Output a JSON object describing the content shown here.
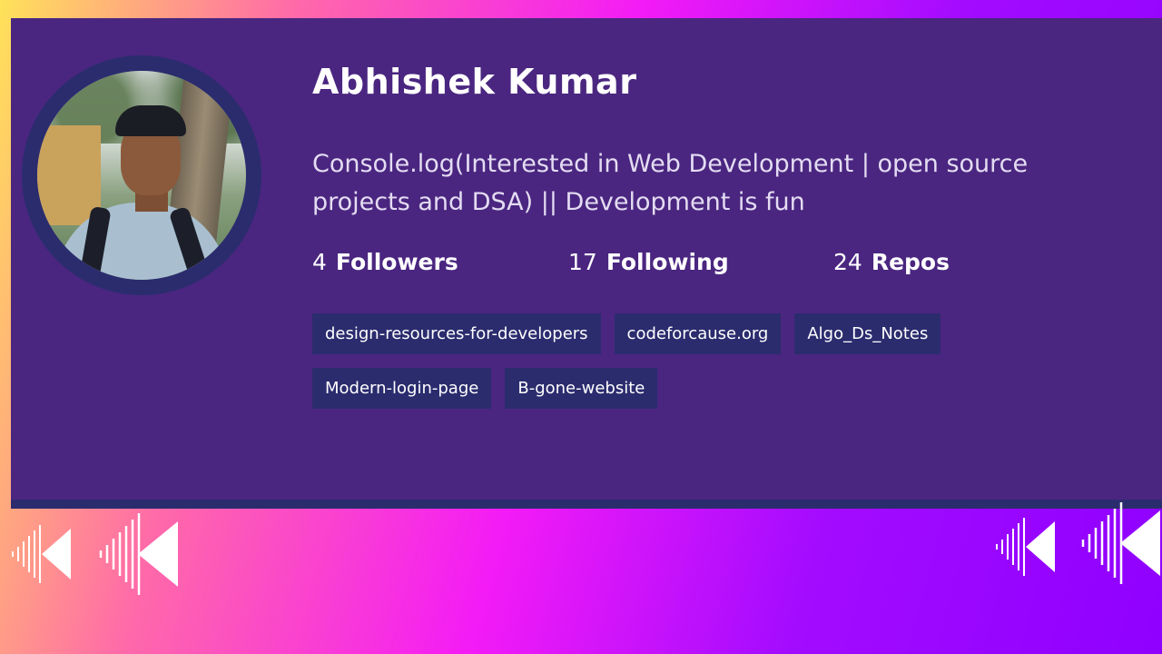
{
  "profile": {
    "name": "Abhishek Kumar",
    "bio": "Console.log(Interested in Web Development | open source projects and DSA) || Development is fun",
    "avatar_icon": "profile-photo"
  },
  "stats": [
    {
      "value": "4",
      "label": "Followers"
    },
    {
      "value": "17",
      "label": "Following"
    },
    {
      "value": "24",
      "label": "Repos"
    }
  ],
  "repos": [
    "design-resources-for-developers",
    "codeforcause.org",
    "Algo_Ds_Notes",
    "Modern-login-page",
    "B-gone-website"
  ],
  "colors": {
    "card_bg": "#4a2680",
    "accent_dark": "#2b2c6e",
    "text": "#ffffff"
  },
  "decor_icons": [
    "sound-triangle-left-icon",
    "sound-triangle-left-icon",
    "sound-triangle-left-icon",
    "sound-triangle-left-icon"
  ]
}
